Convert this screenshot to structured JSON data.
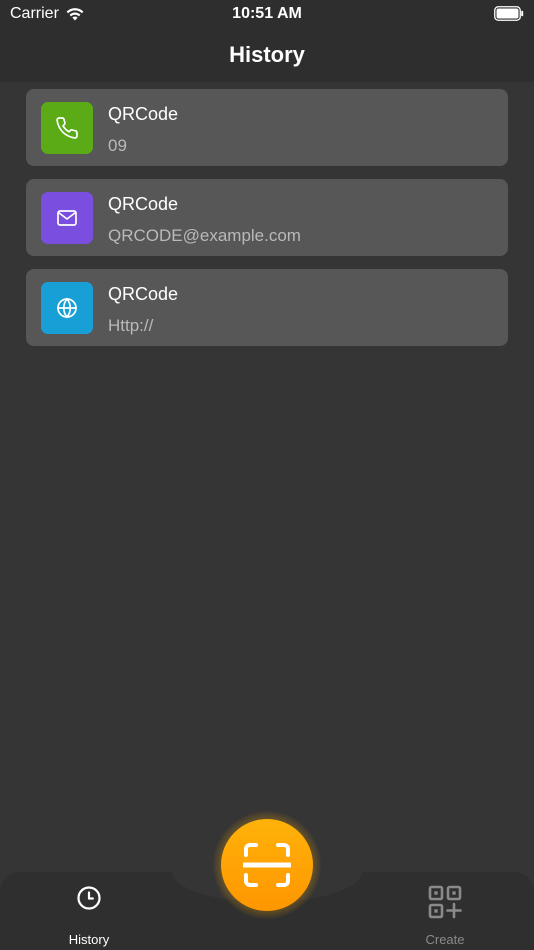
{
  "status_bar": {
    "carrier": "Carrier",
    "time": "10:51 AM",
    "wifi_icon": "wifi-icon",
    "battery_icon": "battery-full-icon"
  },
  "nav": {
    "title": "History"
  },
  "history_items": [
    {
      "title": "QRCode",
      "subtitle": "09",
      "icon": "phone-icon",
      "color": "#5aab16"
    },
    {
      "title": "QRCode",
      "subtitle": "QRCODE@example.com",
      "icon": "mail-icon",
      "color": "#7a4fe0"
    },
    {
      "title": "QRCode",
      "subtitle": "Http://",
      "icon": "globe-icon",
      "color": "#179fd6"
    }
  ],
  "tab_bar": {
    "history_label": "History",
    "create_label": "Create",
    "history_icon": "clock-icon",
    "create_icon": "qr-add-icon",
    "active_color": "#ffffff",
    "inactive_color": "#8a8a8a"
  },
  "scan_button": {
    "icon": "scan-icon",
    "color": "#ffa400"
  },
  "colors": {
    "background": "#353535",
    "card": "#575757",
    "bar": "#2e2e2e"
  }
}
